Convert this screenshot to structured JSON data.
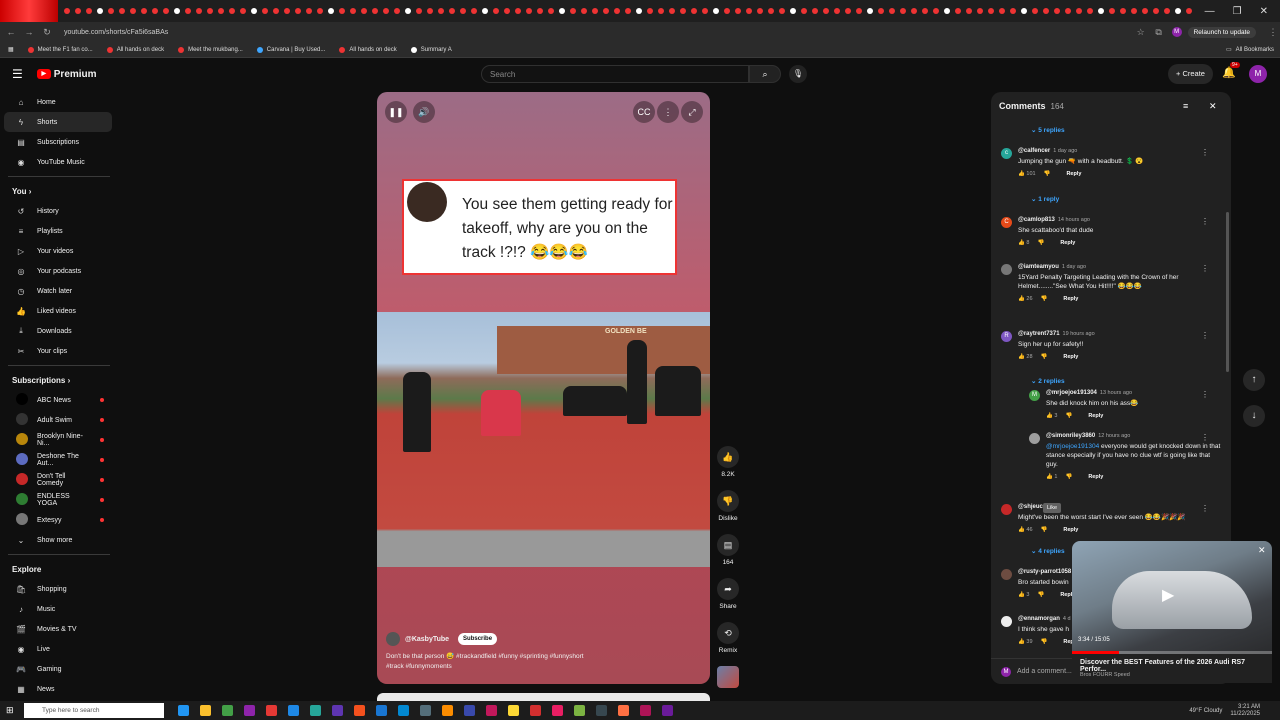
{
  "browser": {
    "url": "youtube.com/shorts/cFa5i6saBAs",
    "relaunch_label": "Relaunch to update",
    "profile_initial": "M",
    "window_controls": [
      "—",
      "❐",
      "✕"
    ],
    "bookmarks": [
      "Meet the F1 fan co...",
      "All hands on deck",
      "Meet the mukbang...",
      "Carvana | Buy Used...",
      "All hands on deck",
      "Summary A"
    ],
    "all_bookmarks_label": "All Bookmarks"
  },
  "header": {
    "logo_text": "Premium",
    "search_placeholder": "Search",
    "create_label": "+ Create",
    "notif_badge": "9+",
    "avatar_initial": "M"
  },
  "sidebar": {
    "main": [
      {
        "label": "Home",
        "icon": "⌂"
      },
      {
        "label": "Shorts",
        "icon": "ϟ"
      },
      {
        "label": "Subscriptions",
        "icon": "▤"
      },
      {
        "label": "YouTube Music",
        "icon": "◉"
      }
    ],
    "you_title": "You ›",
    "you": [
      {
        "label": "History",
        "icon": "↺"
      },
      {
        "label": "Playlists",
        "icon": "≡"
      },
      {
        "label": "Your videos",
        "icon": "▷"
      },
      {
        "label": "Your podcasts",
        "icon": "◎"
      },
      {
        "label": "Watch later",
        "icon": "◷"
      },
      {
        "label": "Liked videos",
        "icon": "👍"
      },
      {
        "label": "Downloads",
        "icon": "⤓"
      },
      {
        "label": "Your clips",
        "icon": "✂"
      }
    ],
    "subs_title": "Subscriptions ›",
    "subs": [
      "ABC News",
      "Adult Swim",
      "Brooklyn Nine-Ni...",
      "Deshone The Aut...",
      "Don't Tell Comedy",
      "ENDLESS YOGA",
      "Extesyy"
    ],
    "show_more": "Show more",
    "explore_title": "Explore",
    "explore": [
      {
        "label": "Shopping",
        "icon": "🛍"
      },
      {
        "label": "Music",
        "icon": "♪"
      },
      {
        "label": "Movies & TV",
        "icon": "🎬"
      },
      {
        "label": "Live",
        "icon": "◉"
      },
      {
        "label": "Gaming",
        "icon": "🎮"
      },
      {
        "label": "News",
        "icon": "▦"
      }
    ]
  },
  "short": {
    "caption": "You see them getting ready for takeoff, why are you on the track !?!? 😂😂😂",
    "school_sign": "GOLDEN BE",
    "channel": "@KasbyTube",
    "subscribe_label": "Subscribe",
    "description_1": "Don't be that person 😅 #trackandfield #funny #sprinting #funnyshort",
    "description_2": "#track #funnymoments"
  },
  "actions": {
    "likes": "8.2K",
    "dislike": "Dislike",
    "comments": "164",
    "share": "Share",
    "remix": "Remix"
  },
  "comments": {
    "title": "Comments",
    "count": "164",
    "top_replies": "5 replies",
    "items": [
      {
        "author": "@calfencer",
        "time": "1 day ago",
        "text": "Jumping the gun 🔫 with a headbutt. 💲 😮",
        "likes": "101",
        "avatar_color": "#26a69a",
        "initial": "c",
        "replies": "1 reply"
      },
      {
        "author": "@camlop813",
        "time": "14 hours ago",
        "text": "She scattaboo'd that dude",
        "likes": "8",
        "avatar_color": "#e64a19",
        "initial": "C"
      },
      {
        "author": "@iamteamyou",
        "time": "1 day ago",
        "text": "15Yard Penalty Targeting Leading with the Crown of her Helmet........\"See What You Hit!!!!\" 😂😂😂",
        "likes": "26",
        "avatar_color": "#777777",
        "initial": ""
      },
      {
        "author": "@raytrent7371",
        "time": "19 hours ago",
        "text": "Sign her up for safety!!",
        "likes": "28",
        "avatar_color": "#7e57c2",
        "initial": "R",
        "replies": "2 replies"
      }
    ],
    "replies": [
      {
        "author": "@mrjoejoe191304",
        "time": "13 hours ago",
        "text": "She did knock him on his ass😂",
        "likes": "3",
        "avatar_color": "#43a047",
        "initial": "M"
      },
      {
        "author": "@simonriley3860",
        "time": "12 hours ago",
        "mention": "@mrjoejoe191304",
        "text": " everyone would get knocked down in that stance especially if you have no clue wtf is going like that guy.",
        "likes": "1",
        "avatar_color": "#9e9e9e",
        "initial": ""
      }
    ],
    "more": [
      {
        "author": "@shjeuc",
        "time": "ago",
        "text": "Might've been the worst start I've ever seen 😂😂🎉🎉🎉",
        "likes": "46",
        "avatar_color": "#c62828",
        "initial": "",
        "replies": "4 replies"
      },
      {
        "author": "@rusty-parrot1058",
        "time": "",
        "text": "Bro started bowin",
        "likes": "3",
        "avatar_color": "#6d4c41",
        "initial": ""
      },
      {
        "author": "@ennamorgan",
        "time": "4 d",
        "text": "I think she gave h",
        "likes": "39",
        "avatar_color": "#eeeeee",
        "initial": ""
      }
    ],
    "reply_label": "Reply",
    "like_tooltip": "Like",
    "add_placeholder": "Add a comment..."
  },
  "mini_player": {
    "time": "3:34 / 15:05",
    "progress": 0.236,
    "title": "Discover the BEST Features of the 2026 Audi RS7 Perfor...",
    "channel": "Bros FOURR Speed"
  },
  "taskbar": {
    "search_placeholder": "Type here to search",
    "weather": "49°F Cloudy",
    "time": "3:21 AM",
    "date": "11/22/2025"
  },
  "colors": {
    "accent": "#ff0000",
    "link": "#3ea6ff",
    "panel": "#212121",
    "bg": "#0f0f0f"
  }
}
